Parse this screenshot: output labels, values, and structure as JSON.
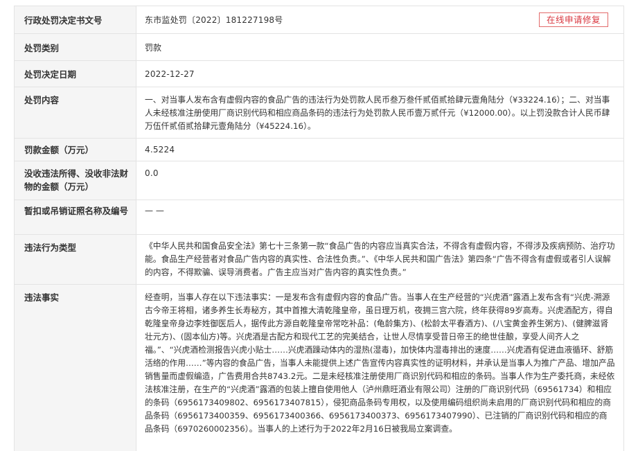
{
  "online_repair_button": "在线申请修复",
  "rows": [
    {
      "label": "行政处罚决定书文号",
      "value": "东市监处罚〔2022〕181227198号"
    },
    {
      "label": "处罚类别",
      "value": "罚款"
    },
    {
      "label": "处罚决定日期",
      "value": "2022-12-27"
    },
    {
      "label": "处罚内容",
      "value": "一、对当事人发布含有虚假内容的食品广告的违法行为处罚款人民币叁万叁仟贰佰贰拾肆元壹角陆分（¥33224.16）；二、对当事人未经核准注册使用厂商识别代码和相应商品条码的违法行为处罚款人民币壹万贰仟元（¥12000.00）。以上罚没款合计人民币肆万伍仟贰佰贰拾肆元壹角陆分（¥45224.16）。"
    },
    {
      "label": "罚款金额（万元）",
      "value": "4.5224"
    },
    {
      "label": "没收违法所得、没收非法财物的金额（万元）",
      "value": "0.0"
    },
    {
      "label": "暂扣或吊销证照名称及编号",
      "value": "— —"
    },
    {
      "label": "违法行为类型",
      "value": "《中华人民共和国食品安全法》第七十三条第一款“食品广告的内容应当真实合法，不得含有虚假内容，不得涉及疾病预防、治疗功能。食品生产经营者对食品广告内容的真实性、合法性负责。”、《中华人民共和国广告法》第四条“广告不得含有虚假或者引人误解的内容，不得欺骗、误导消费者。广告主应当对广告内容的真实性负责。”"
    },
    {
      "label": "违法事实",
      "value": "经查明，当事人存在以下违法事实：一是发布含有虚假内容的食品广告。当事人在生产经营的“兴虎酒”露酒上发布含有“兴虎-溯源古今帝王将相，诸多养生长寿秘方，其中首推大清乾隆皇帝，虽日理万机，夜拥三宫六院，终年获得89岁高寿。兴虎酒配方，得自乾隆皇帝身边李姓御医后人，据传此方源自乾隆皇帝常吃补品：(龟龄集方)、(松龄太平春酒方)、(八宝黄金养生粥方)、(健脾滋肾壮元方)、(固本仙方)等。兴虎酒是古配方和现代工艺的完美结合，让世人尽情享受昔日帝王的绝世佳酿，享受人间齐人之福。”、“兴虎酒检测报告兴虎小贴士……兴虎酒躁动体内的湿热(湿毒)，加快体内湿毒排出的速度……兴虎酒有促进血液循环、舒筋活络的作用……”等内容的食品广告，当事人未能提供上述广告宣传内容真实性的证明材料，并承认是当事人为推广产品、增加产品销售量而虚假编造，广告费用合共8743.2元。二是未经核准注册使用厂商识别代码和相应的条码。当事人作为生产委托商，未经依法核准注册，在生产的“兴虎酒”露酒的包装上擅自使用他人（泸州鼎旺酒业有限公司）注册的厂商识别代码（69561734）和相应的条码（69561734098​02、6956173407815），侵犯商品条码专用权，以及使用编码组织尚未启用的厂商识别代码和相应的商品条码（6956173400359、6956173400366、6956173400373、6956173407990）、已注销的厂商识别代码和相应的商品条码（6970260002356）。当事人的上述行为于2022年2月16日被我局立案调查。"
    }
  ]
}
